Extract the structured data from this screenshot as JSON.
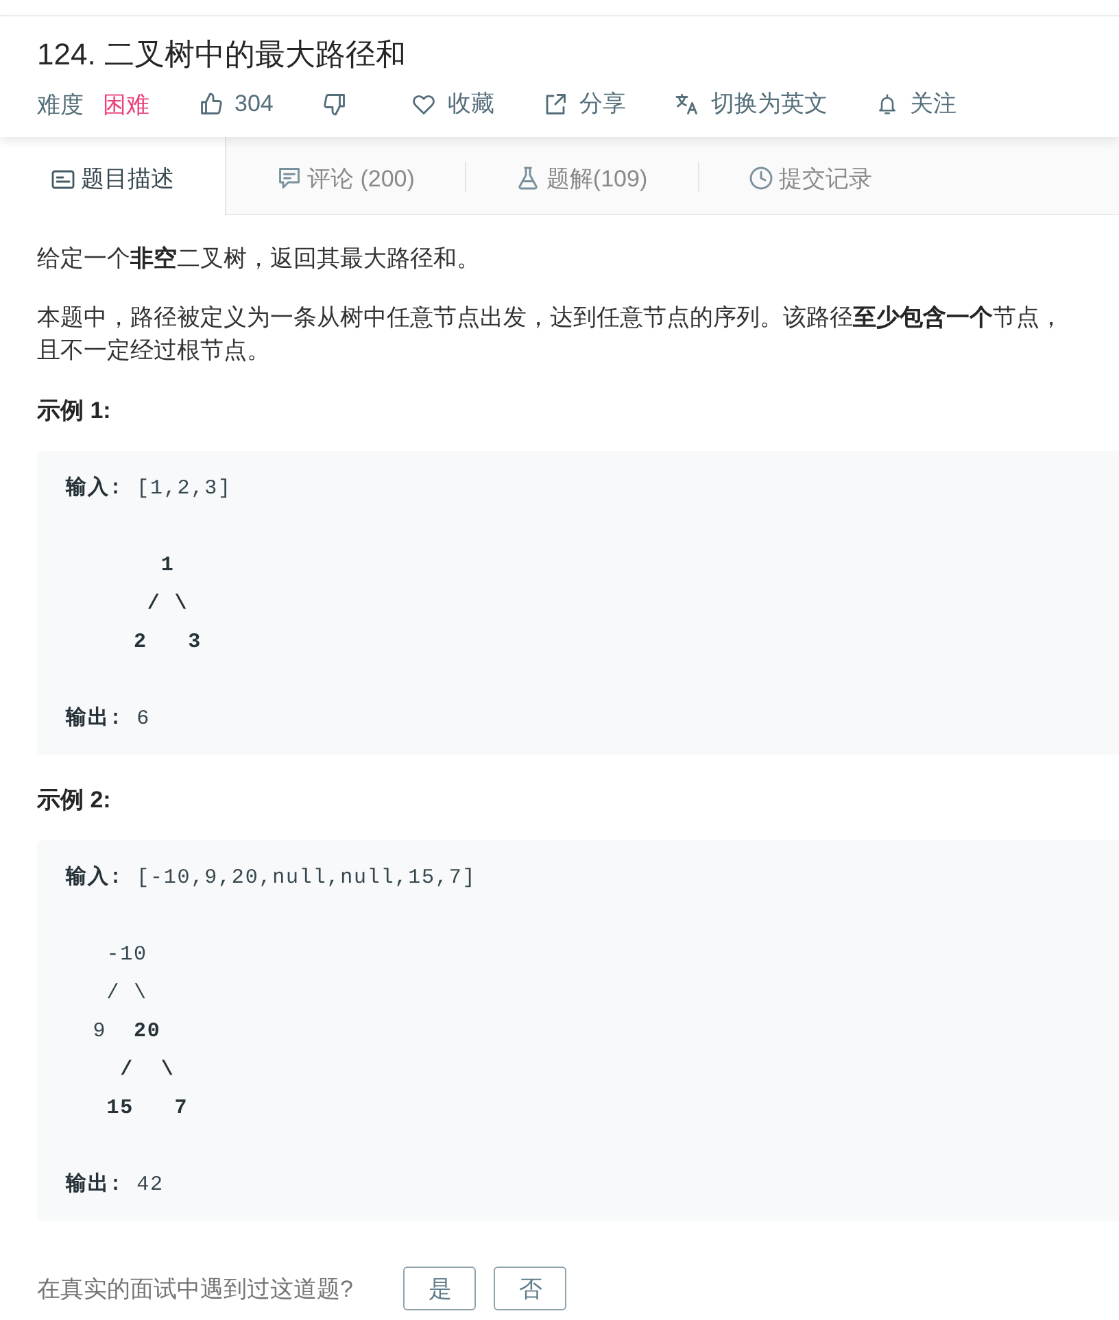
{
  "header": {
    "title": "124. 二叉树中的最大路径和",
    "difficulty": {
      "label": "难度",
      "value": "困难",
      "kind": "hard"
    },
    "actions": [
      {
        "kind": "like",
        "label": "304"
      },
      {
        "kind": "dislike"
      },
      {
        "kind": "favorite",
        "label": "收藏"
      },
      {
        "kind": "share",
        "label": "分享"
      },
      {
        "kind": "translate",
        "label": "切换为英文"
      },
      {
        "kind": "follow",
        "label": "关注"
      }
    ]
  },
  "tabs": [
    {
      "kind": "description",
      "label": "题目描述",
      "selected": true
    },
    {
      "kind": "comments",
      "label": "评论 (200)",
      "selected": false
    },
    {
      "kind": "solutions",
      "label": "题解(109)",
      "selected": false
    },
    {
      "kind": "submissions",
      "label": "提交记录",
      "selected": false
    }
  ],
  "description": {
    "paragraphs": [
      "给定一个**非空**二叉树，返回其最大路径和。",
      "本题中，路径被定义为一条从树中任意节点出发，达到任意节点的序列。该路径**至少包含一个**节点，且不一定经过根节点。"
    ],
    "examples": [
      {
        "heading": "示例 1:",
        "input": "**输入:** [1,2,3]",
        "tree": "       **1**\n      **/ \\**\n     **2   3**",
        "output": "**输出:** 6"
      },
      {
        "heading": "示例 2:",
        "input": "**输入:** [-10,9,20,null,null,15,7]",
        "tree": "   -10\n   / \\\n  9  **20**\n    **/  \\**\n   **15   7**",
        "output": "**输出:** 42"
      }
    ]
  },
  "footer": {
    "question": "在真实的面试中遇到过这道题?",
    "answers": [
      "是",
      "否"
    ]
  }
}
